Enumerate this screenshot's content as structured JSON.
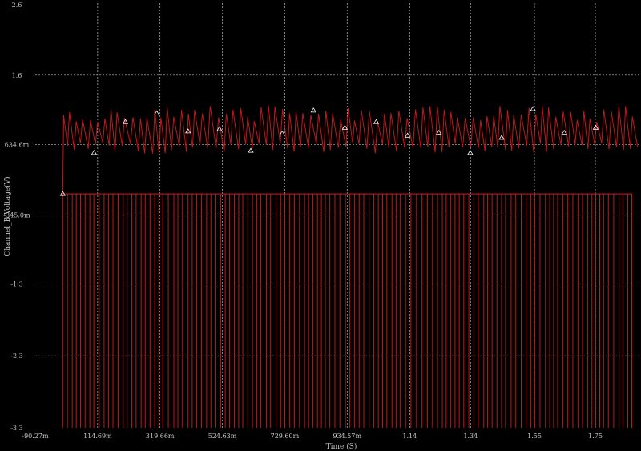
{
  "chart_data": {
    "type": "line",
    "title": "",
    "xlabel": "Time (S)",
    "ylabel": "Channel_B Voltage(V)",
    "xlim": [
      -0.09027,
      1.9
    ],
    "ylim": [
      -3.3,
      2.6
    ],
    "x_ticks": [
      {
        "value": -0.09027,
        "label": "-90.27m"
      },
      {
        "value": 0.11469,
        "label": "114.69m"
      },
      {
        "value": 0.31966,
        "label": "319.66m"
      },
      {
        "value": 0.52463,
        "label": "524.63m"
      },
      {
        "value": 0.7296,
        "label": "729.60m"
      },
      {
        "value": 0.93457,
        "label": "934.57m"
      },
      {
        "value": 1.14,
        "label": "1.14"
      },
      {
        "value": 1.34,
        "label": "1.34"
      },
      {
        "value": 1.55,
        "label": "1.55"
      },
      {
        "value": 1.75,
        "label": "1.75"
      }
    ],
    "y_ticks": [
      {
        "value": 2.6,
        "label": "2.6"
      },
      {
        "value": 1.6,
        "label": "1.6"
      },
      {
        "value": 0.6346,
        "label": "634.6m"
      },
      {
        "value": -0.345,
        "label": "-345.0m"
      },
      {
        "value": -1.3,
        "label": "-1.3"
      },
      {
        "value": -2.3,
        "label": "-2.3"
      },
      {
        "value": -3.3,
        "label": "-3.3"
      }
    ],
    "grid": true,
    "background": "#000000",
    "grid_color": "#bdbdbd",
    "series_color": "#c0181c",
    "marker_color": "#ffffff",
    "series": [
      {
        "name": "",
        "marker": "triangle",
        "pulse": {
          "high": -0.05,
          "low": -3.3,
          "start": 0.0,
          "end": 1.87
        },
        "sawtooth": {
          "baseline": 0.66,
          "mid": 0.95,
          "peak": 1.18,
          "start": 0.0,
          "end": 1.87,
          "period": 0.0235
        },
        "marker_points": [
          [
            0.0,
            -0.05
          ],
          [
            0.103,
            0.52
          ],
          [
            0.206,
            0.95
          ],
          [
            0.309,
            1.07
          ],
          [
            0.412,
            0.82
          ],
          [
            0.515,
            0.85
          ],
          [
            0.618,
            0.55
          ],
          [
            0.721,
            0.79
          ],
          [
            0.824,
            1.11
          ],
          [
            0.927,
            0.87
          ],
          [
            1.03,
            0.95
          ],
          [
            1.133,
            0.76
          ],
          [
            1.236,
            0.8
          ],
          [
            1.339,
            0.52
          ],
          [
            1.442,
            0.73
          ],
          [
            1.545,
            1.13
          ],
          [
            1.648,
            0.8
          ],
          [
            1.751,
            0.87
          ]
        ]
      }
    ]
  }
}
